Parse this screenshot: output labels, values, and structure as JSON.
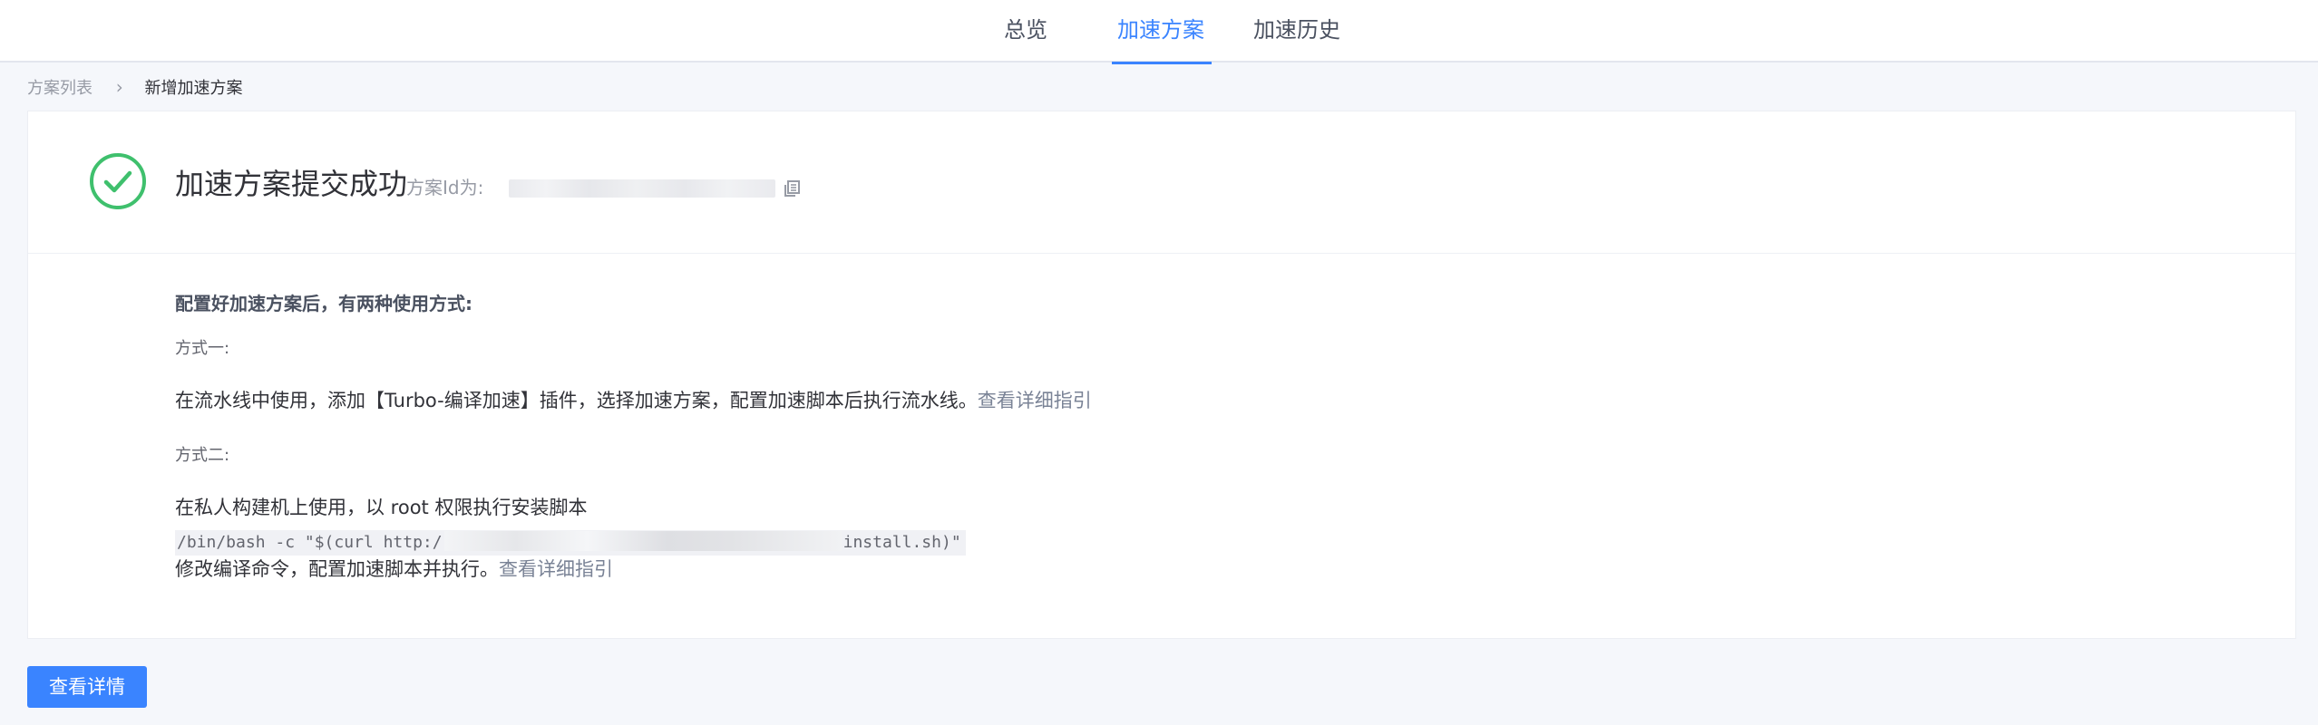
{
  "nav": {
    "tabs": [
      {
        "label": "总览",
        "active": false
      },
      {
        "label": "加速方案",
        "active": true
      },
      {
        "label": "加速历史",
        "active": false
      }
    ]
  },
  "breadcrumb": {
    "parent": "方案列表",
    "separator": "›",
    "current": "新增加速方案"
  },
  "result": {
    "icon": "check-circle-icon",
    "title": "加速方案提交成功",
    "id_label": "方案Id为:",
    "id_value": ""
  },
  "guide": {
    "heading": "配置好加速方案后，有两种使用方式:",
    "way1": {
      "label": "方式一:",
      "text": "在流水线中使用，添加【Turbo-编译加速】插件，选择加速方案，配置加速脚本后执行流水线。",
      "link": "查看详细指引"
    },
    "way2": {
      "label": "方式二:",
      "text": "在私人构建机上使用，以 root 权限执行安装脚本",
      "command_prefix": "/bin/bash -c \"$(curl http:/",
      "command_suffix": "install.sh)\"",
      "note": "修改编译命令，配置加速脚本并执行。",
      "link": "查看详细指引"
    }
  },
  "actions": {
    "view_detail": "查看详情"
  },
  "colors": {
    "primary": "#3a84ff",
    "success": "#3fc06d"
  }
}
